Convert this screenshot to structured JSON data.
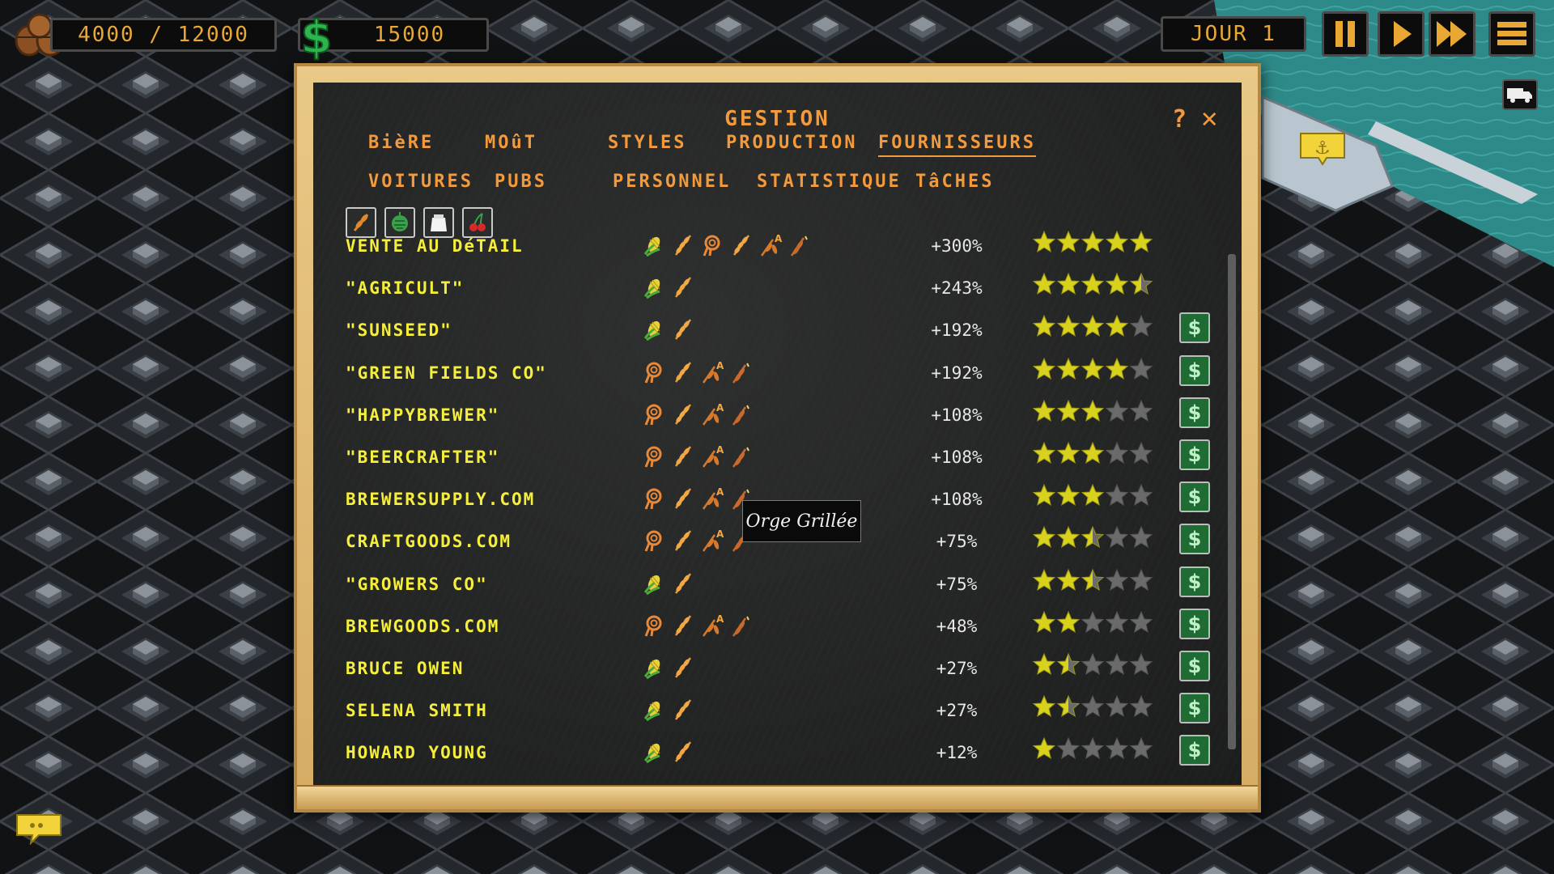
{
  "hud": {
    "storage": "4000 / 12000",
    "money": "15000",
    "day": "JOUR 1"
  },
  "panel": {
    "title": "GESTION",
    "help": "?",
    "close": "✕",
    "tabs": [
      {
        "label": "BièRE",
        "active": false
      },
      {
        "label": "MOûT",
        "active": false
      },
      {
        "label": "STYLES",
        "active": false
      },
      {
        "label": "PRODUCTION",
        "active": false
      },
      {
        "label": "FOURNISSEURS",
        "active": true
      },
      {
        "label": "VOITURES",
        "active": false
      },
      {
        "label": "PUBS",
        "active": false
      },
      {
        "label": "PERSONNEL",
        "active": false
      },
      {
        "label": "STATISTIQUE",
        "active": false
      },
      {
        "label": "TâCHES",
        "active": false
      }
    ],
    "filters": [
      "wheat-filter-icon",
      "hops-filter-icon",
      "sugar-filter-icon",
      "cherry-filter-icon"
    ]
  },
  "suppliers": [
    {
      "name": "VENTE AU DéTAIL",
      "icons": [
        "corn",
        "wheat",
        "swirl",
        "wheat",
        "wheat-a",
        "wheat-dark"
      ],
      "bonus": "+300%",
      "rating": 5,
      "buy": false
    },
    {
      "name": "\"AGRICULT\"",
      "icons": [
        "corn",
        "wheat"
      ],
      "bonus": "+243%",
      "rating": 4.5,
      "buy": false
    },
    {
      "name": "\"SUNSEED\"",
      "icons": [
        "corn",
        "wheat"
      ],
      "bonus": "+192%",
      "rating": 4,
      "buy": true
    },
    {
      "name": "\"GREEN FIELDS CO\"",
      "icons": [
        "swirl",
        "wheat",
        "wheat-a",
        "wheat-dark"
      ],
      "bonus": "+192%",
      "rating": 4,
      "buy": true
    },
    {
      "name": "\"HAPPYBREWER\"",
      "icons": [
        "swirl",
        "wheat",
        "wheat-a",
        "wheat-dark"
      ],
      "bonus": "+108%",
      "rating": 3,
      "buy": true
    },
    {
      "name": "\"BEERCRAFTER\"",
      "icons": [
        "swirl",
        "wheat",
        "wheat-a",
        "wheat-dark"
      ],
      "bonus": "+108%",
      "rating": 3,
      "buy": true
    },
    {
      "name": "BREWERSUPPLY.COM",
      "icons": [
        "swirl",
        "wheat",
        "wheat-a",
        "wheat-dark"
      ],
      "bonus": "+108%",
      "rating": 3,
      "buy": true
    },
    {
      "name": "CRAFTGOODS.COM",
      "icons": [
        "swirl",
        "wheat",
        "wheat-a",
        "wheat-dark"
      ],
      "bonus": "+75%",
      "rating": 2.5,
      "buy": true
    },
    {
      "name": "\"GROWERS CO\"",
      "icons": [
        "corn",
        "wheat"
      ],
      "bonus": "+75%",
      "rating": 2.5,
      "buy": true
    },
    {
      "name": "BREWGOODS.COM",
      "icons": [
        "swirl",
        "wheat",
        "wheat-a",
        "wheat-dark"
      ],
      "bonus": "+48%",
      "rating": 2,
      "buy": true
    },
    {
      "name": "BRUCE OWEN",
      "icons": [
        "corn",
        "wheat"
      ],
      "bonus": "+27%",
      "rating": 1.5,
      "buy": true
    },
    {
      "name": "SELENA SMITH",
      "icons": [
        "corn",
        "wheat"
      ],
      "bonus": "+27%",
      "rating": 1.5,
      "buy": true
    },
    {
      "name": "HOWARD YOUNG",
      "icons": [
        "corn",
        "wheat"
      ],
      "bonus": "+12%",
      "rating": 1,
      "buy": true
    }
  ],
  "tooltip": "Orge Grillée",
  "colors": {
    "chalk_orange": "#f29a3c",
    "chalk_yellow": "#f5ee3a",
    "star_on": "#d8d21c",
    "star_off": "#6a6a6a",
    "buy_green": "#1e6b33"
  }
}
